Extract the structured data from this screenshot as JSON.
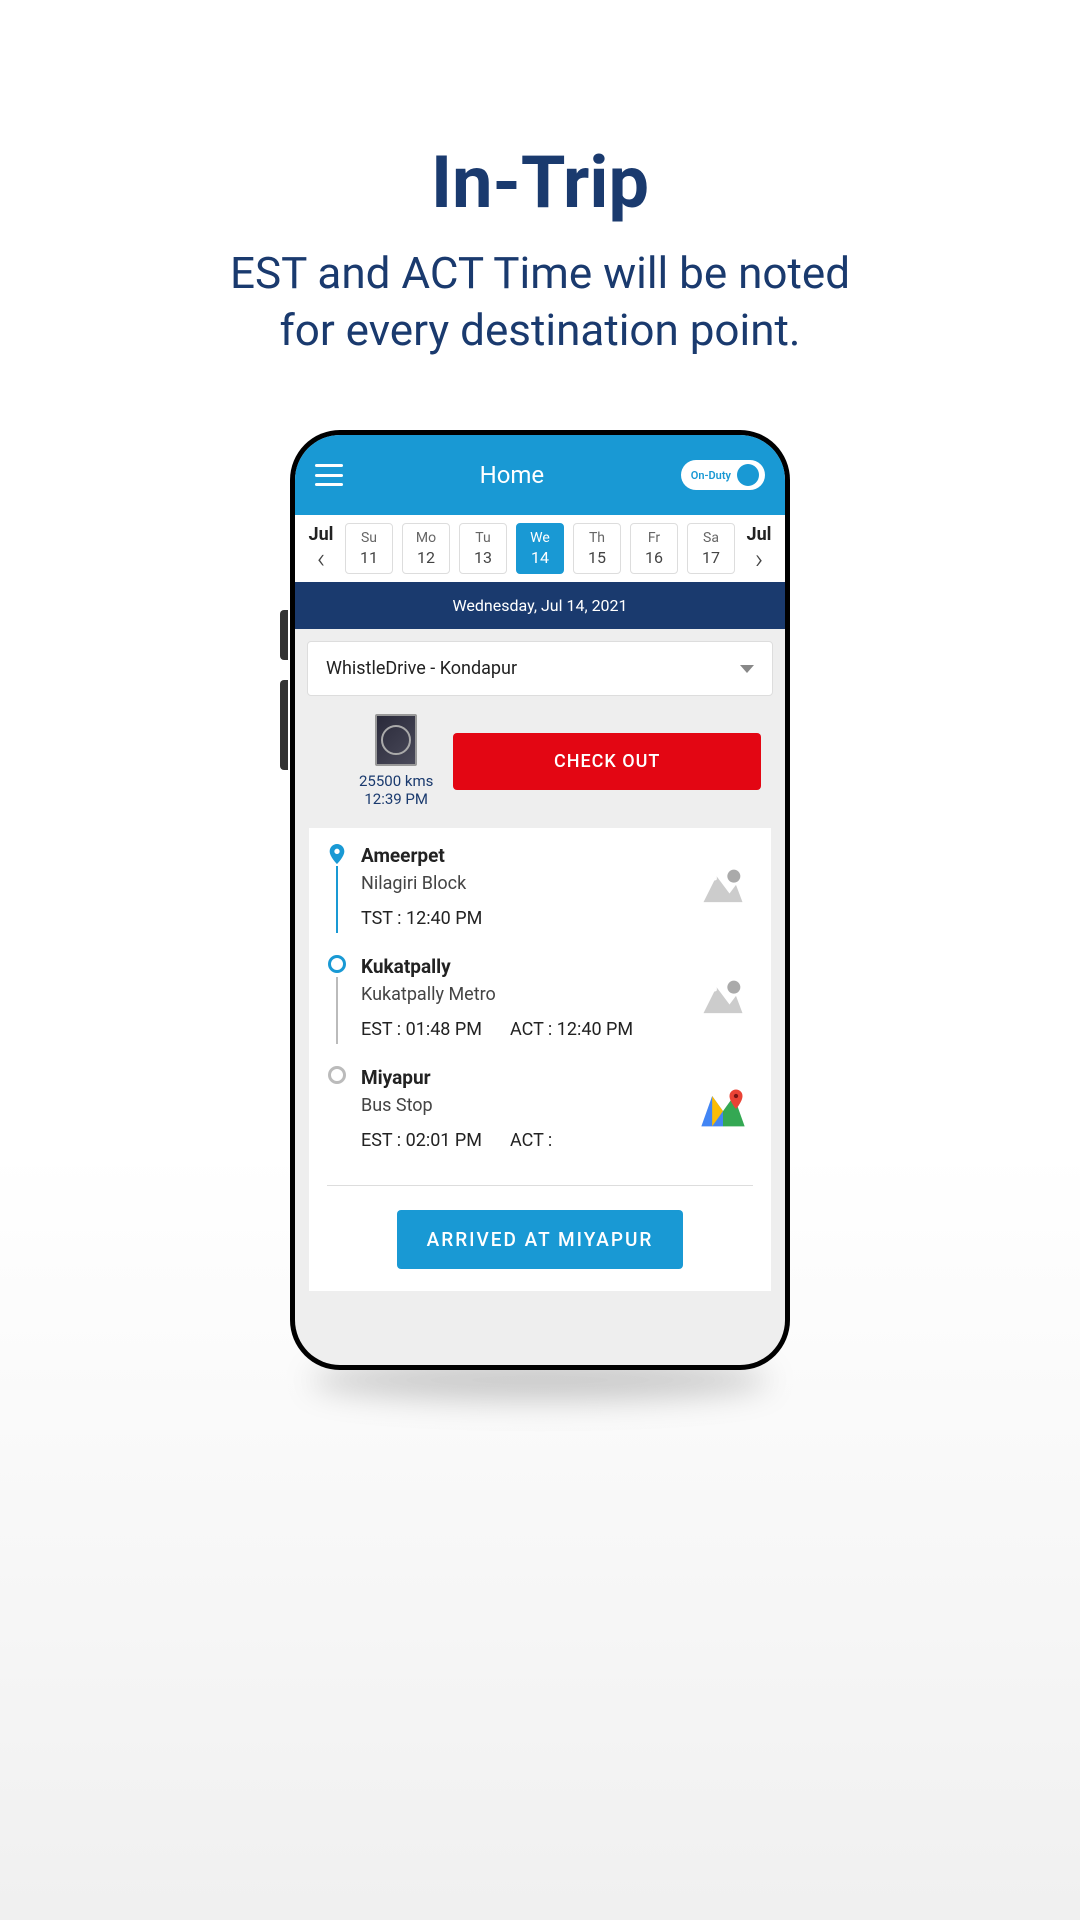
{
  "header": {
    "title": "In-Trip",
    "subtitle_l1": "EST and ACT Time will be noted",
    "subtitle_l2": "for every destination point."
  },
  "app": {
    "title": "Home",
    "duty_label": "On-Duty"
  },
  "calendar": {
    "month_left": "Jul",
    "month_right": "Jul",
    "days": [
      {
        "name": "Su",
        "num": "11"
      },
      {
        "name": "Mo",
        "num": "12"
      },
      {
        "name": "Tu",
        "num": "13"
      },
      {
        "name": "We",
        "num": "14"
      },
      {
        "name": "Th",
        "num": "15"
      },
      {
        "name": "Fr",
        "num": "16"
      },
      {
        "name": "Sa",
        "num": "17"
      }
    ],
    "active_index": 3,
    "full_date": "Wednesday,  Jul 14, 2021"
  },
  "dropdown": {
    "selected": "WhistleDrive - Kondapur"
  },
  "odo": {
    "kms": "25500 kms",
    "time": "12:39 PM"
  },
  "checkout_label": "CHECK OUT",
  "stops": [
    {
      "name": "Ameerpet",
      "sub": "Nilagiri Block",
      "t1": "TST : 12:40 PM",
      "t2": ""
    },
    {
      "name": "Kukatpally",
      "sub": "Kukatpally Metro",
      "t1": "EST : 01:48 PM",
      "t2": "ACT : 12:40 PM"
    },
    {
      "name": "Miyapur",
      "sub": "Bus Stop",
      "t1": "EST : 02:01 PM",
      "t2": "ACT :"
    }
  ],
  "arrive_label": "ARRIVED AT MIYAPUR"
}
